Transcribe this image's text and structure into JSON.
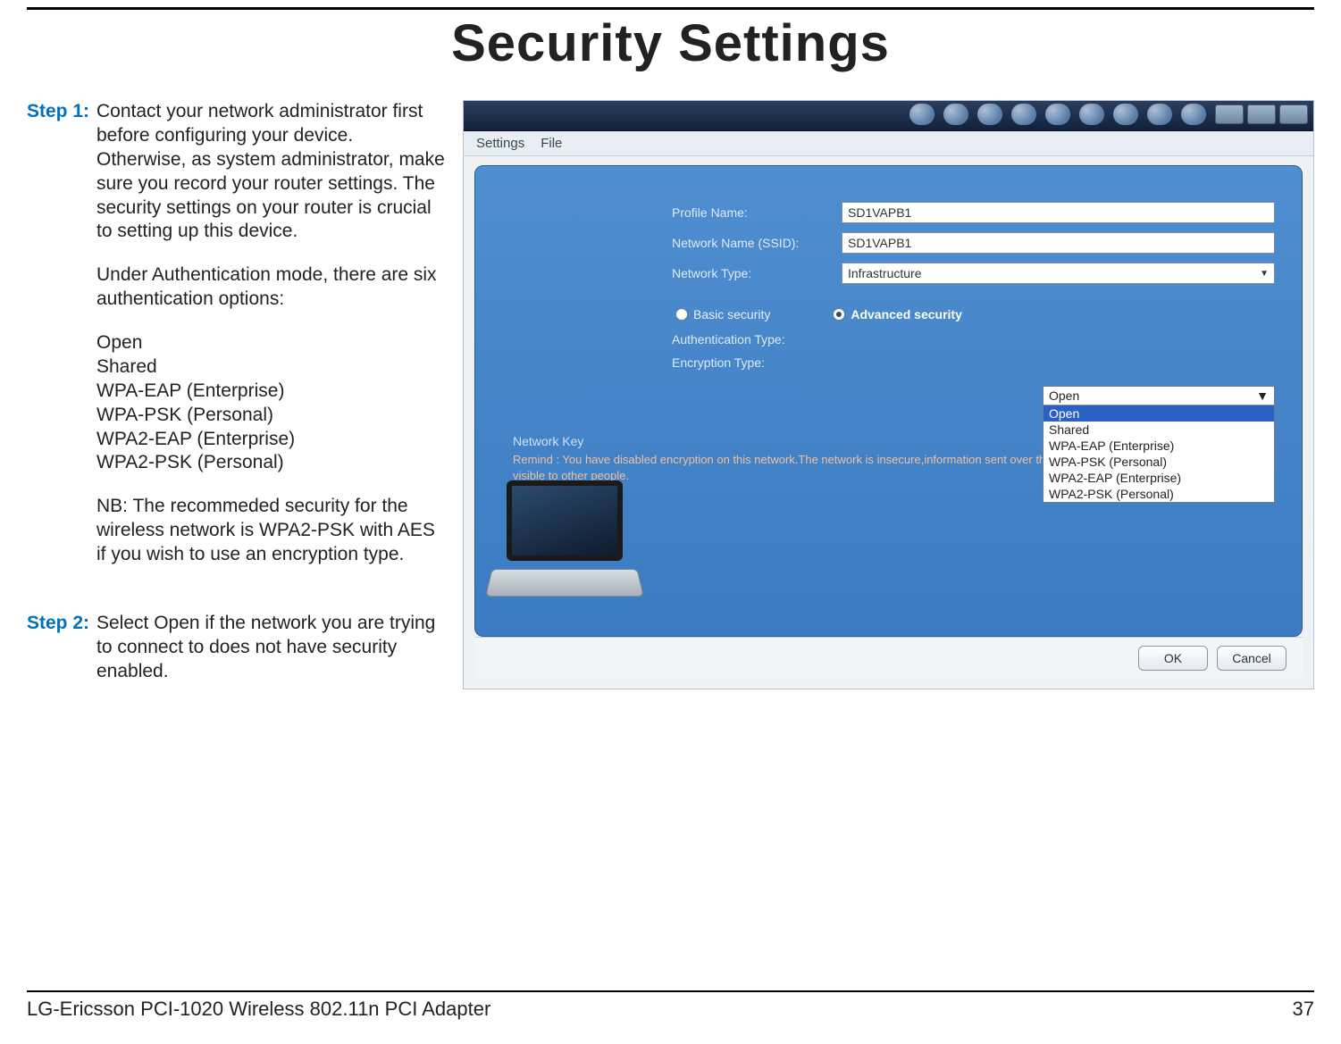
{
  "page": {
    "title": "Security Settings",
    "footer_product": "LG-Ericsson PCI-1020 Wireless 802.11n PCI Adapter",
    "footer_page": "37"
  },
  "steps": [
    {
      "label": "Step 1:",
      "paragraphs": [
        "Contact your network administrator first before configuring your device. Otherwise, as system administrator, make sure you record your router settings. The security settings on your router is crucial to setting up this device.",
        "Under Authentication mode, there are six authentication options:"
      ],
      "list": [
        "Open",
        "Shared",
        "WPA-EAP (Enterprise)",
        "WPA-PSK (Personal)",
        "WPA2-EAP (Enterprise)",
        "WPA2-PSK (Personal)"
      ],
      "note": "NB: The recommeded security for the wireless network is WPA2-PSK with AES if you wish to use an encryption type."
    },
    {
      "label": "Step 2:",
      "paragraphs": [
        "Select Open if the network you are trying to connect to does not have security enabled."
      ],
      "list": [],
      "note": ""
    }
  ],
  "dialog": {
    "menus": {
      "settings": "Settings",
      "file": "File"
    },
    "fields": {
      "profile_name_label": "Profile Name:",
      "profile_name_value": "SD1VAPB1",
      "ssid_label": "Network Name (SSID):",
      "ssid_value": "SD1VAPB1",
      "network_type_label": "Network Type:",
      "network_type_value": "Infrastructure"
    },
    "radios": {
      "basic": "Basic security",
      "advanced": "Advanced security",
      "selected": "advanced"
    },
    "auth": {
      "label": "Authentication Type:",
      "value": "Open",
      "options": [
        "Open",
        "Shared",
        "WPA-EAP (Enterprise)",
        "WPA-PSK (Personal)",
        "WPA2-EAP (Enterprise)",
        "WPA2-PSK (Personal)"
      ]
    },
    "encryption_label": "Encryption Type:",
    "network_key_label": "Network Key",
    "remind": "Remind : You have disabled encryption on this network.The network is insecure,information sent over this newwork is not encrypted and might be visible to other people.",
    "buttons": {
      "ok": "OK",
      "cancel": "Cancel"
    }
  }
}
